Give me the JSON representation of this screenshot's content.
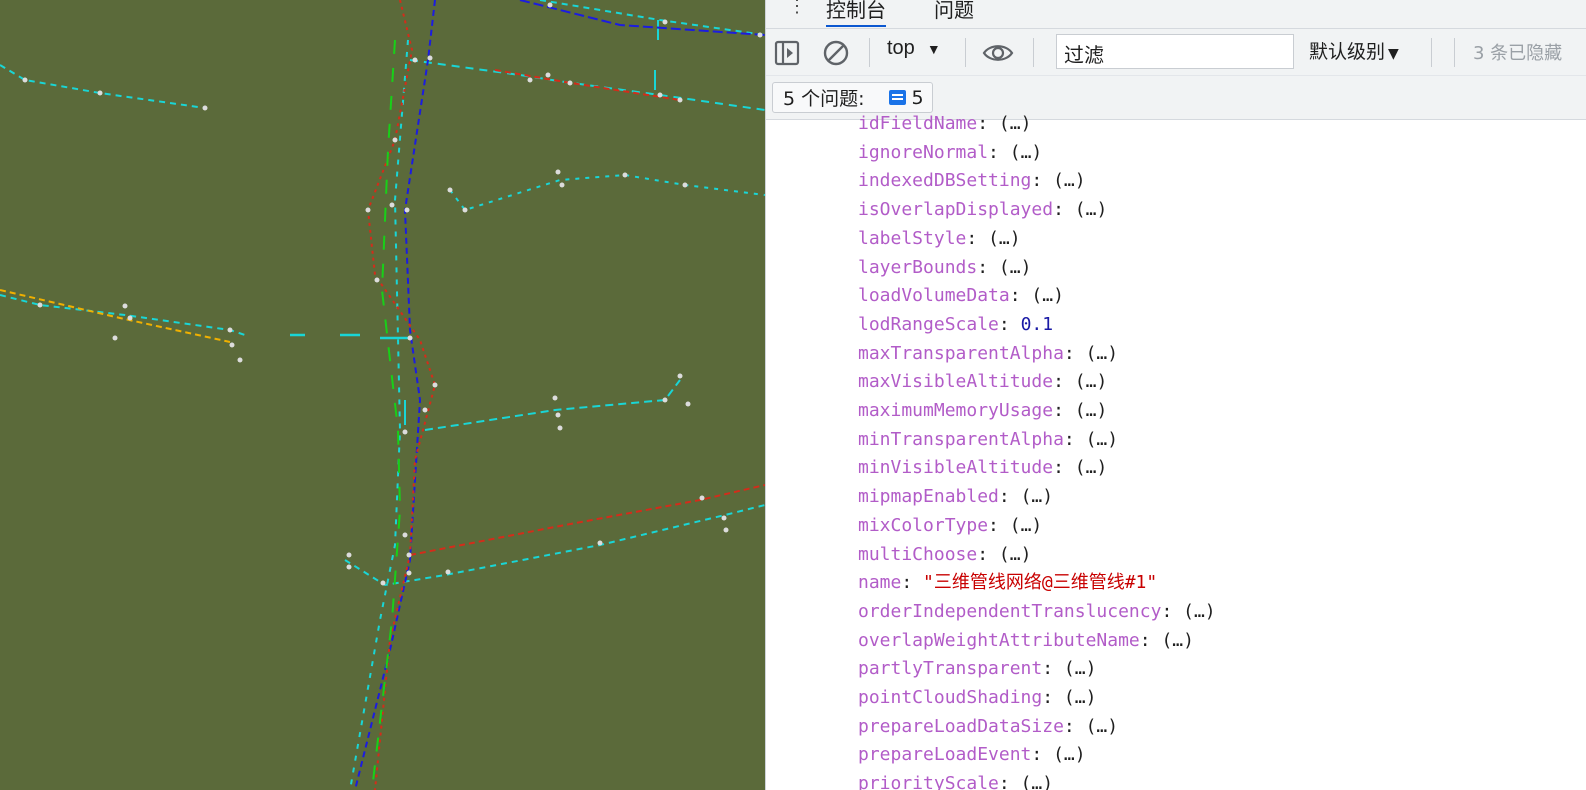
{
  "devtools": {
    "tabs": [
      {
        "label": "控制台",
        "active": true
      },
      {
        "label": "问题",
        "active": false
      }
    ],
    "toolbar": {
      "context": "top",
      "filter_placeholder": "过滤",
      "log_level": "默认级别",
      "hidden_count": "3 条已隐藏"
    },
    "issues": {
      "label": "5 个问题:",
      "count": "5"
    },
    "properties": [
      {
        "key": "idFieldName",
        "value": "(…)",
        "type": "collapsed"
      },
      {
        "key": "ignoreNormal",
        "value": "(…)",
        "type": "collapsed"
      },
      {
        "key": "indexedDBSetting",
        "value": "(…)",
        "type": "collapsed"
      },
      {
        "key": "isOverlapDisplayed",
        "value": "(…)",
        "type": "collapsed"
      },
      {
        "key": "labelStyle",
        "value": "(…)",
        "type": "collapsed"
      },
      {
        "key": "layerBounds",
        "value": "(…)",
        "type": "collapsed"
      },
      {
        "key": "loadVolumeData",
        "value": "(…)",
        "type": "collapsed"
      },
      {
        "key": "lodRangeScale",
        "value": "0.1",
        "type": "num"
      },
      {
        "key": "maxTransparentAlpha",
        "value": "(…)",
        "type": "collapsed"
      },
      {
        "key": "maxVisibleAltitude",
        "value": "(…)",
        "type": "collapsed"
      },
      {
        "key": "maximumMemoryUsage",
        "value": "(…)",
        "type": "collapsed"
      },
      {
        "key": "minTransparentAlpha",
        "value": "(…)",
        "type": "collapsed"
      },
      {
        "key": "minVisibleAltitude",
        "value": "(…)",
        "type": "collapsed"
      },
      {
        "key": "mipmapEnabled",
        "value": "(…)",
        "type": "collapsed"
      },
      {
        "key": "mixColorType",
        "value": "(…)",
        "type": "collapsed"
      },
      {
        "key": "multiChoose",
        "value": "(…)",
        "type": "collapsed"
      },
      {
        "key": "name",
        "value": "\"三维管线网络@三维管线#1\"",
        "type": "str"
      },
      {
        "key": "orderIndependentTranslucency",
        "value": "(…)",
        "type": "collapsed"
      },
      {
        "key": "overlapWeightAttributeName",
        "value": "(…)",
        "type": "collapsed"
      },
      {
        "key": "partlyTransparent",
        "value": "(…)",
        "type": "collapsed"
      },
      {
        "key": "pointCloudShading",
        "value": "(…)",
        "type": "collapsed"
      },
      {
        "key": "prepareLoadDataSize",
        "value": "(…)",
        "type": "collapsed"
      },
      {
        "key": "prepareLoadEvent",
        "value": "(…)",
        "type": "collapsed"
      },
      {
        "key": "priorityScale",
        "value": "(…)",
        "type": "collapsed"
      }
    ]
  },
  "colors": {
    "scene_bg": "#5b6a3a",
    "cyan_line": "#19d6d6",
    "red_line": "#d42c1a",
    "blue_line": "#1c1ce0",
    "green_line": "#18d018",
    "orange_line": "#f0b000",
    "prop_key": "#b25cc8",
    "string_value": "#c80000",
    "number_value": "#1a1aa6"
  }
}
